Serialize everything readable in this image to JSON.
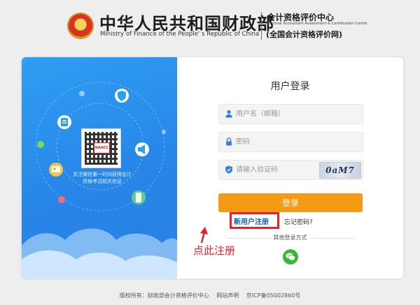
{
  "header": {
    "ministry_cn": "中华人民共和国财政部",
    "ministry_en": "Ministry of Finance of the People' s Republic of China",
    "center_cn": "会计资格评价中心",
    "center_en": "National Accountant Assessment & Certification Centre",
    "center_portal": "(全国会计资格评价网)"
  },
  "promo": {
    "qr_logo_text": "NAACC",
    "caption": "关注微信第一时间获得会计资格考试相关信息"
  },
  "login": {
    "title": "用户登录",
    "username_placeholder": "用户名（邮箱）",
    "password_placeholder": "密码",
    "captcha_placeholder": "请输入验证码",
    "captcha_text": "0aM7",
    "login_label": "登录",
    "register_label": "新用户注册",
    "forgot_label": "忘记密码?",
    "other_login_label": "其他登录方式"
  },
  "annotation": {
    "text": "点此注册"
  },
  "footer": {
    "copyright": "版权所有：财政部会计资格评价中心",
    "statement": "网站声明",
    "icp": "京ICP备05002860号"
  },
  "colors": {
    "login_button": "#f59a14",
    "highlight_red": "#e8202a",
    "panel_blue": "#2786e8",
    "wechat_green": "#3bb83b"
  },
  "icons": [
    "emblem-icon",
    "user-icon",
    "lock-icon",
    "shield-icon",
    "wechat-icon"
  ]
}
